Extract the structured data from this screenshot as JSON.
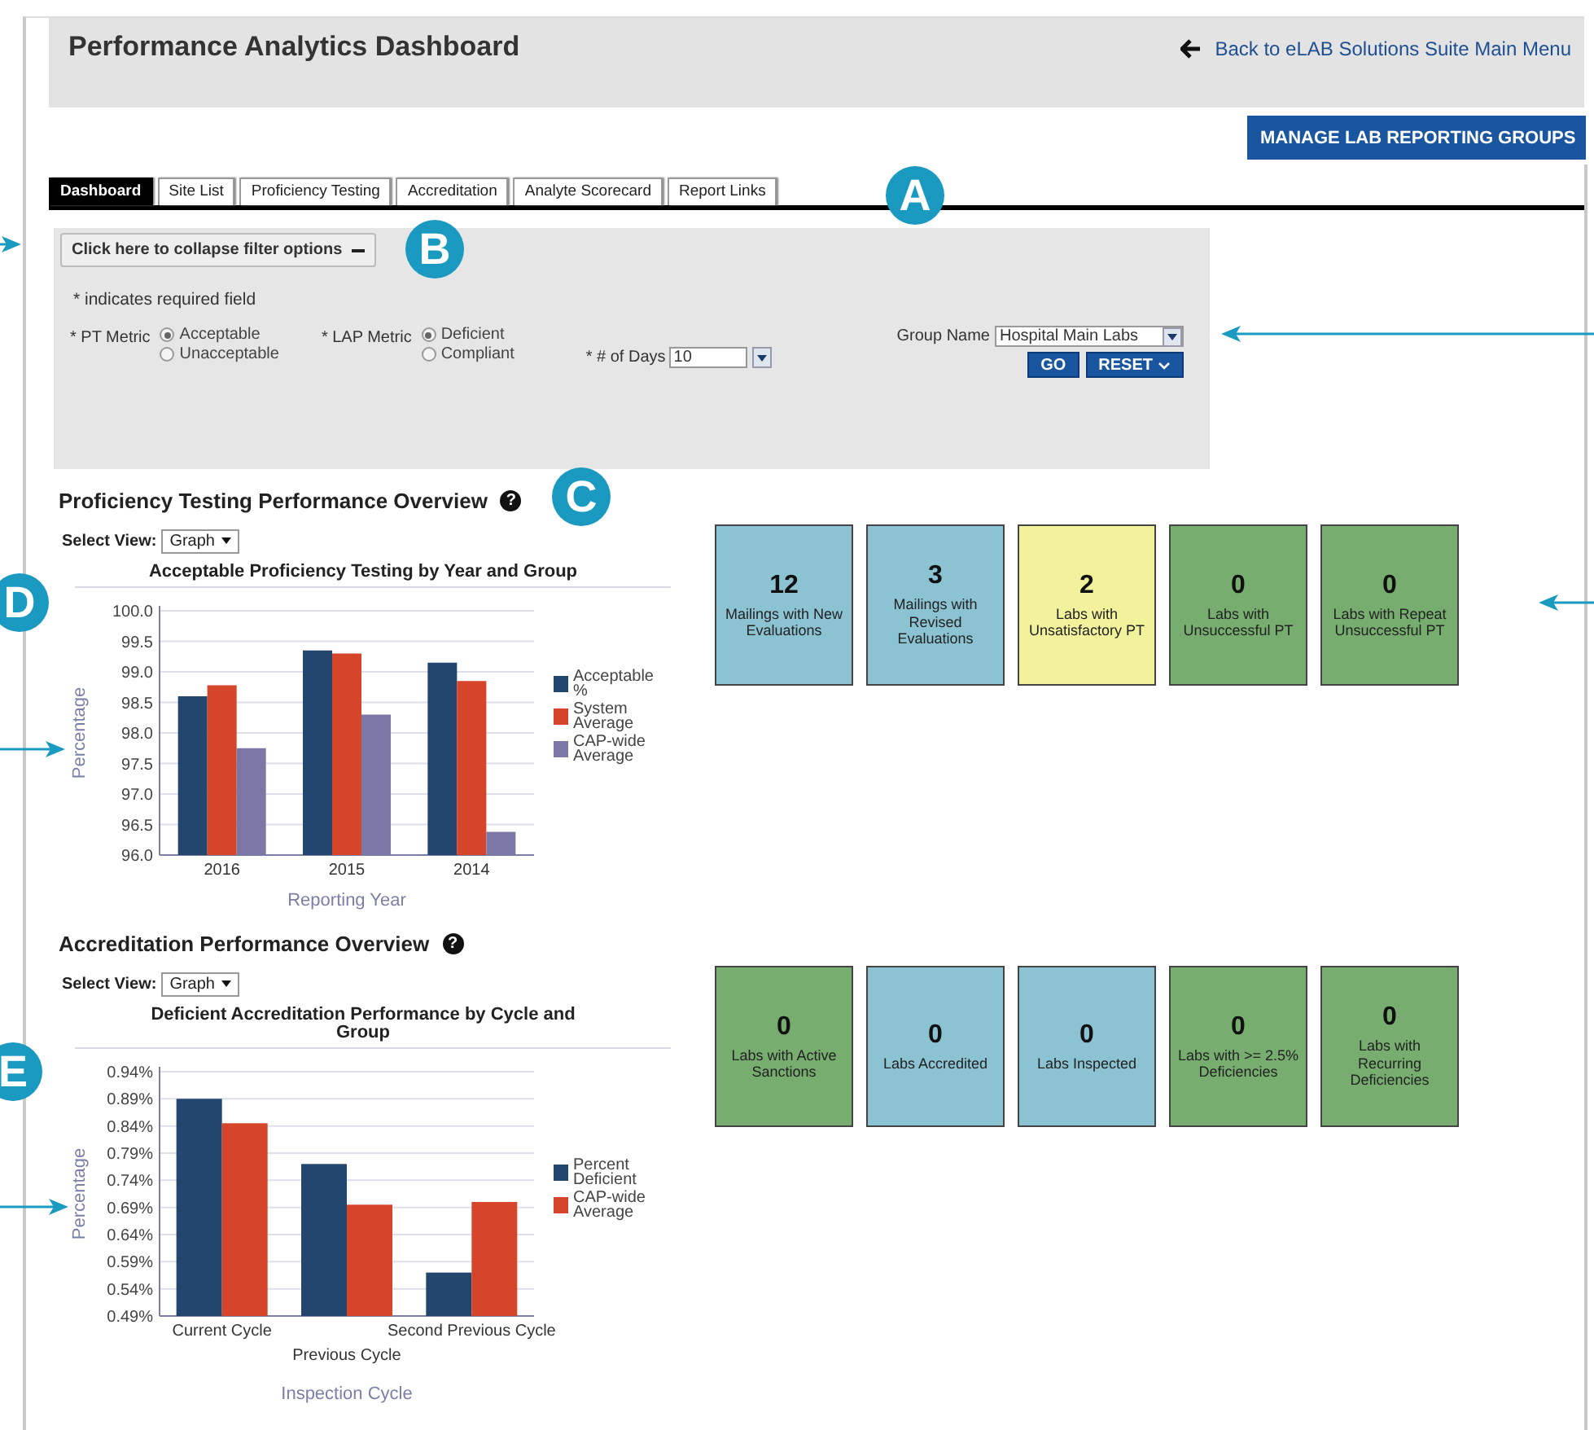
{
  "header": {
    "title": "Performance Analytics Dashboard",
    "back_link": "Back to eLAB Solutions Suite Main Menu"
  },
  "manage_button": "MANAGE LAB REPORTING GROUPS",
  "tabs": [
    {
      "label": "Dashboard",
      "selected": true
    },
    {
      "label": "Site List",
      "selected": false
    },
    {
      "label": "Proficiency Testing",
      "selected": false
    },
    {
      "label": "Accreditation",
      "selected": false
    },
    {
      "label": "Analyte Scorecard",
      "selected": false
    },
    {
      "label": "Report Links",
      "selected": false
    }
  ],
  "filter": {
    "collapse_button": "Click here to collapse filter options",
    "required_note": "* indicates required field",
    "pt_metric": {
      "label": "* PT Metric",
      "options": [
        {
          "label": "Acceptable",
          "selected": true
        },
        {
          "label": "Unacceptable",
          "selected": false
        }
      ]
    },
    "lap_metric": {
      "label": "* LAP Metric",
      "options": [
        {
          "label": "Deficient",
          "selected": true
        },
        {
          "label": "Compliant",
          "selected": false
        }
      ]
    },
    "days": {
      "label": "* # of Days",
      "value": "10"
    },
    "group_name": {
      "label": "Group Name",
      "value": "Hospital Main Labs"
    },
    "buttons": [
      "GO",
      "RESET"
    ]
  },
  "sections": [
    {
      "title": "Proficiency Testing Performance Overview",
      "help_icon": "?",
      "select_view": {
        "label": "Select View:",
        "value": "Graph"
      },
      "chart_data": {
        "type": "bar",
        "title": "Acceptable Proficiency Testing by Year and Group",
        "xlabel": "Reporting Year",
        "ylabel": "Percentage",
        "categories": [
          "2016",
          "2015",
          "2014"
        ],
        "series": [
          {
            "name": "Acceptable %",
            "color": "#23466e",
            "values": [
              98.6,
              99.35,
              99.15
            ]
          },
          {
            "name": "System Average",
            "color": "#d6452a",
            "values": [
              98.78,
              99.3,
              98.85
            ]
          },
          {
            "name": "CAP-wide Average",
            "color": "#7b78a6",
            "values": [
              97.75,
              98.3,
              96.38
            ]
          }
        ],
        "grid": true,
        "legend": "right",
        "ylim": [
          96,
          100
        ],
        "yticks": [
          {
            "value": 96,
            "label": "96.0"
          },
          {
            "value": 96.5,
            "label": "96.5"
          },
          {
            "value": 97,
            "label": "97.0"
          },
          {
            "value": 97.5,
            "label": "97.5"
          },
          {
            "value": 98,
            "label": "98.0"
          },
          {
            "value": 98.5,
            "label": "98.5"
          },
          {
            "value": 99,
            "label": "99.0"
          },
          {
            "value": 99.5,
            "label": "99.5"
          },
          {
            "value": 100,
            "label": "100.0"
          }
        ]
      },
      "tiles": [
        {
          "value": "12",
          "label": "Mailings with New Evaluations",
          "color": "#8cc3d2"
        },
        {
          "value": "3",
          "label": "Mailings with Revised Evaluations",
          "color": "#8cc3d2"
        },
        {
          "value": "2",
          "label": "Labs with Unsatisfactory PT",
          "color": "#f2f29c"
        },
        {
          "value": "0",
          "label": "Labs with Unsuccessful PT",
          "color": "#77ae70"
        },
        {
          "value": "0",
          "label": "Labs with Repeat Unsuccessful PT",
          "color": "#77ae70"
        }
      ]
    },
    {
      "title": "Accreditation Performance Overview",
      "help_icon": "?",
      "select_view": {
        "label": "Select View:",
        "value": "Graph"
      },
      "chart_data": {
        "type": "bar",
        "title": "Deficient Accreditation Performance by Cycle and Group",
        "xlabel": "Inspection Cycle",
        "ylabel": "Percentage",
        "categories": [
          "Current Cycle",
          "Previous Cycle",
          "Second Previous Cycle"
        ],
        "series": [
          {
            "name": "Percent Deficient",
            "color": "#23466e",
            "values": [
              0.89,
              0.77,
              0.57
            ]
          },
          {
            "name": "CAP-wide Average",
            "color": "#d6452a",
            "values": [
              0.845,
              0.695,
              0.7
            ]
          }
        ],
        "grid": true,
        "legend": "right",
        "ylim": [
          0.49,
          0.94
        ],
        "yticks": [
          {
            "value": 0.49,
            "label": "0.49%"
          },
          {
            "value": 0.54,
            "label": "0.54%"
          },
          {
            "value": 0.59,
            "label": "0.59%"
          },
          {
            "value": 0.64,
            "label": "0.64%"
          },
          {
            "value": 0.69,
            "label": "0.69%"
          },
          {
            "value": 0.74,
            "label": "0.74%"
          },
          {
            "value": 0.79,
            "label": "0.79%"
          },
          {
            "value": 0.84,
            "label": "0.84%"
          },
          {
            "value": 0.89,
            "label": "0.89%"
          },
          {
            "value": 0.94,
            "label": "0.94%"
          }
        ]
      },
      "tiles": [
        {
          "value": "0",
          "label": "Labs with Active Sanctions",
          "color": "#77ae70"
        },
        {
          "value": "0",
          "label": "Labs Accredited",
          "color": "#8cc3d2"
        },
        {
          "value": "0",
          "label": "Labs Inspected",
          "color": "#8cc3d2"
        },
        {
          "value": "0",
          "label": "Labs with >= 2.5% Deficiencies",
          "color": "#77ae70"
        },
        {
          "value": "0",
          "label": "Labs with Recurring Deficiencies",
          "color": "#77ae70"
        }
      ]
    }
  ],
  "callouts": [
    {
      "letter": "A"
    },
    {
      "letter": "B"
    },
    {
      "letter": "C"
    },
    {
      "letter": "D"
    },
    {
      "letter": "E"
    }
  ]
}
